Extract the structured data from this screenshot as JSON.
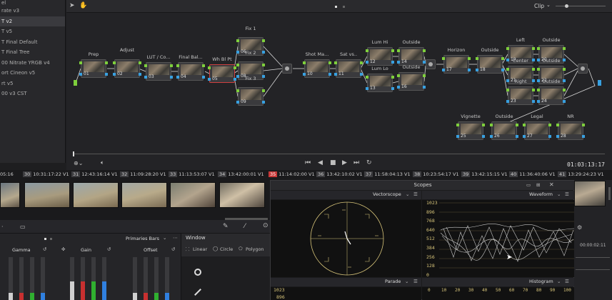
{
  "node_list": [
    {
      "label": "rate v3",
      "selected": false
    },
    {
      "label": "T v2",
      "selected": true
    },
    {
      "label": "T v5",
      "selected": false
    },
    {
      "label": "T Final Default",
      "selected": false
    },
    {
      "label": "T Final Tree",
      "selected": false
    },
    {
      "label": "00 Nitrate YRGB v4",
      "selected": false
    },
    {
      "label": "ort Cineon v5",
      "selected": false
    },
    {
      "label": "rt v5",
      "selected": false
    },
    {
      "label": "00 v3 CST",
      "selected": false
    }
  ],
  "node_list_header": "el",
  "node_toolbar": {
    "clip_label": "Clip"
  },
  "nodes": [
    {
      "id": "n01",
      "label": "Prep",
      "num": "01"
    },
    {
      "id": "n02",
      "label": "Adjust",
      "num": "02"
    },
    {
      "id": "n03",
      "label": "LUT / Co...",
      "num": "03"
    },
    {
      "id": "n04",
      "label": "Final Bal...",
      "num": "04"
    },
    {
      "id": "n05",
      "label": "Wh Bl Pt",
      "num": "05"
    },
    {
      "id": "n06",
      "label": "Fix 1",
      "num": "06"
    },
    {
      "id": "n08",
      "label": "Fix 2",
      "num": "08"
    },
    {
      "id": "n09",
      "label": "Fix 3",
      "num": "09"
    },
    {
      "id": "n10",
      "label": "Shot Ma...",
      "num": "10"
    },
    {
      "id": "n11",
      "label": "Sat vs..",
      "num": "11"
    },
    {
      "id": "n12",
      "label": "Lum Hi",
      "num": "12"
    },
    {
      "id": "n13",
      "label": "Lum Lo",
      "num": "13"
    },
    {
      "id": "n14",
      "label": "Outside",
      "num": "14"
    },
    {
      "id": "n16",
      "label": "Outside",
      "num": "16"
    },
    {
      "id": "n17",
      "label": "Horizon",
      "num": "17"
    },
    {
      "id": "n18",
      "label": "Outside",
      "num": "18"
    },
    {
      "id": "n19",
      "label": "Left",
      "num": "19"
    },
    {
      "id": "n20",
      "label": "Outside",
      "num": "20"
    },
    {
      "id": "n21",
      "label": "Center",
      "num": "21"
    },
    {
      "id": "n22",
      "label": "Outside",
      "num": "22"
    },
    {
      "id": "n23",
      "label": "Right",
      "num": "23"
    },
    {
      "id": "n24",
      "label": "Outside",
      "num": "24"
    },
    {
      "id": "n25",
      "label": "Vignette",
      "num": "25"
    },
    {
      "id": "n26",
      "label": "Outside",
      "num": "26"
    },
    {
      "id": "n27",
      "label": "Legal",
      "num": "27"
    },
    {
      "id": "n28",
      "label": "NR",
      "num": "28"
    }
  ],
  "transport": {
    "timecode": "01:03:13:17"
  },
  "clips": [
    {
      "num": "",
      "tc": "05:16",
      "track": ""
    },
    {
      "num": "30",
      "tc": "10:31:17:22",
      "track": "V1"
    },
    {
      "num": "31",
      "tc": "12:43:16:14",
      "track": "V1"
    },
    {
      "num": "32",
      "tc": "11:09:28:20",
      "track": "V1"
    },
    {
      "num": "33",
      "tc": "11:13:53:07",
      "track": "V1"
    },
    {
      "num": "34",
      "tc": "13:42:00:01",
      "track": "V1"
    },
    {
      "num": "35",
      "tc": "11:14:02:00",
      "track": "V1"
    },
    {
      "num": "36",
      "tc": "13:42:10:02",
      "track": "V1"
    },
    {
      "num": "37",
      "tc": "11:58:04:13",
      "track": "V1"
    },
    {
      "num": "38",
      "tc": "10:23:54:17",
      "track": "V1"
    },
    {
      "num": "39",
      "tc": "13:42:15:15",
      "track": "V1"
    },
    {
      "num": "40",
      "tc": "11:36:40:06",
      "track": "V1"
    },
    {
      "num": "41",
      "tc": "13:29:24:23",
      "track": "V1"
    }
  ],
  "primaries": {
    "title": "Primaries Bars",
    "gamma": "Gamma",
    "gain": "Gain",
    "offset": "Offset"
  },
  "window_panel": {
    "title": "Window",
    "linear": "Linear",
    "circle": "Circle",
    "polygon": "Polygon"
  },
  "scopes": {
    "title": "Scopes",
    "vectorscope": "Vectorscope",
    "waveform": "Waveform",
    "parade": "Parade",
    "histogram": "Histogram",
    "waveform_scale": [
      "1023",
      "896",
      "768",
      "640",
      "512",
      "384",
      "256",
      "128",
      "0"
    ],
    "parade_scale": [
      "1023",
      "896"
    ],
    "histogram_scale": [
      "0",
      "10",
      "20",
      "30",
      "40",
      "50",
      "60",
      "70",
      "80",
      "90",
      "100"
    ]
  },
  "right_side": {
    "timecode": "00:00:02:11"
  },
  "colors": {
    "accent_red": "#c83838",
    "port_green": "#7ecf3c",
    "port_blue": "#38a0e0",
    "scope_gold": "#d8c57a"
  }
}
